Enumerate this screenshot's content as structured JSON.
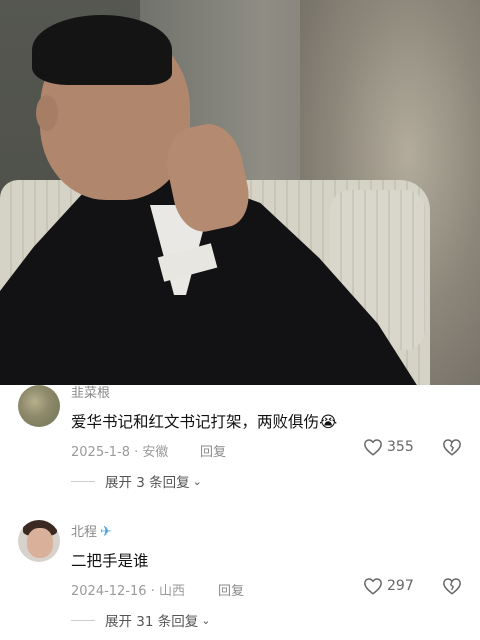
{
  "comments": [
    {
      "username": "韭菜根",
      "text": "爱华书记和红文书记打架，两败俱伤😭",
      "date_location": "2025-1-8 · 安徽",
      "reply_label": "回复",
      "likes": "355",
      "expand_label": "展开 3 条回复"
    },
    {
      "username": "北程",
      "badge": "✈",
      "text": "二把手是谁",
      "date_location": "2024-12-16 · 山西",
      "reply_label": "回复",
      "likes": "297",
      "expand_label": "展开 31 条回复"
    }
  ],
  "icons": {
    "like": "heart-outline-icon",
    "dislike": "broken-heart-icon",
    "expand": "chevron-down-icon"
  }
}
